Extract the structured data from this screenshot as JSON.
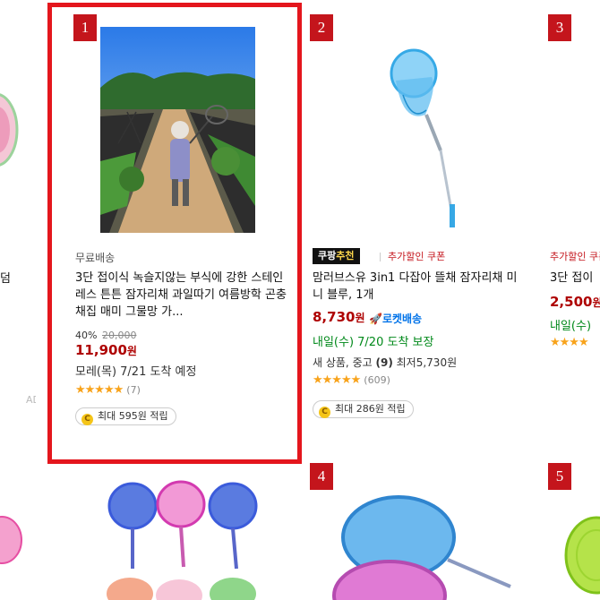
{
  "left_partial": {
    "title_fragment": "덤",
    "ad_label": "ADU"
  },
  "card1": {
    "rank": "1",
    "shipping": "무료배송",
    "title": "3단 접이식 녹슬지않는 부식에 강한 스테인레스 튼튼 잠자리채 과일따기 여름방학 곤충채집 매미 그물망 가...",
    "discount_pct": "40%",
    "original_price": "20,000",
    "price": "11,900",
    "price_unit": "원",
    "delivery": "모레(목) 7/21 도착 예정",
    "rating": 4.5,
    "rating_stars": "★★★★★",
    "review_count": "(7)",
    "coupon": "최대 595원 적립",
    "coin_icon": "C"
  },
  "card2": {
    "rank": "2",
    "badge_prefix": "쿠팡",
    "badge_accent": "추천",
    "extra_label": "추가할인 쿠폰",
    "title": "맘러브스유 3in1 다잡아 뜰채 잠자리채 미니 블루, 1개",
    "price": "8,730",
    "price_unit": "원",
    "rocket": "🚀로켓배송",
    "delivery": "내일(수) 7/20 도착 보장",
    "used_text": "새 상품, 중고",
    "used_count": "(9)",
    "used_min": "최저5,730원",
    "rating": 4.5,
    "rating_stars": "★★★★★",
    "review_count": "(609)",
    "coupon": "최대 286원 적립",
    "coin_icon": "C"
  },
  "card3": {
    "rank": "3",
    "extra_label": "추가할인 쿠폰",
    "title": "3단 접이",
    "price": "2,500",
    "price_unit": "원",
    "delivery": "내일(수)",
    "rating_stars": "★★★★"
  },
  "card4": {
    "rank": "4"
  },
  "card5": {
    "rank": "5"
  },
  "colors": {
    "highlight": "#e4161d",
    "price": "#ae0000",
    "rank_bg": "#c4151c",
    "rocket": "#0073e9",
    "delivery_green": "#00891a"
  }
}
